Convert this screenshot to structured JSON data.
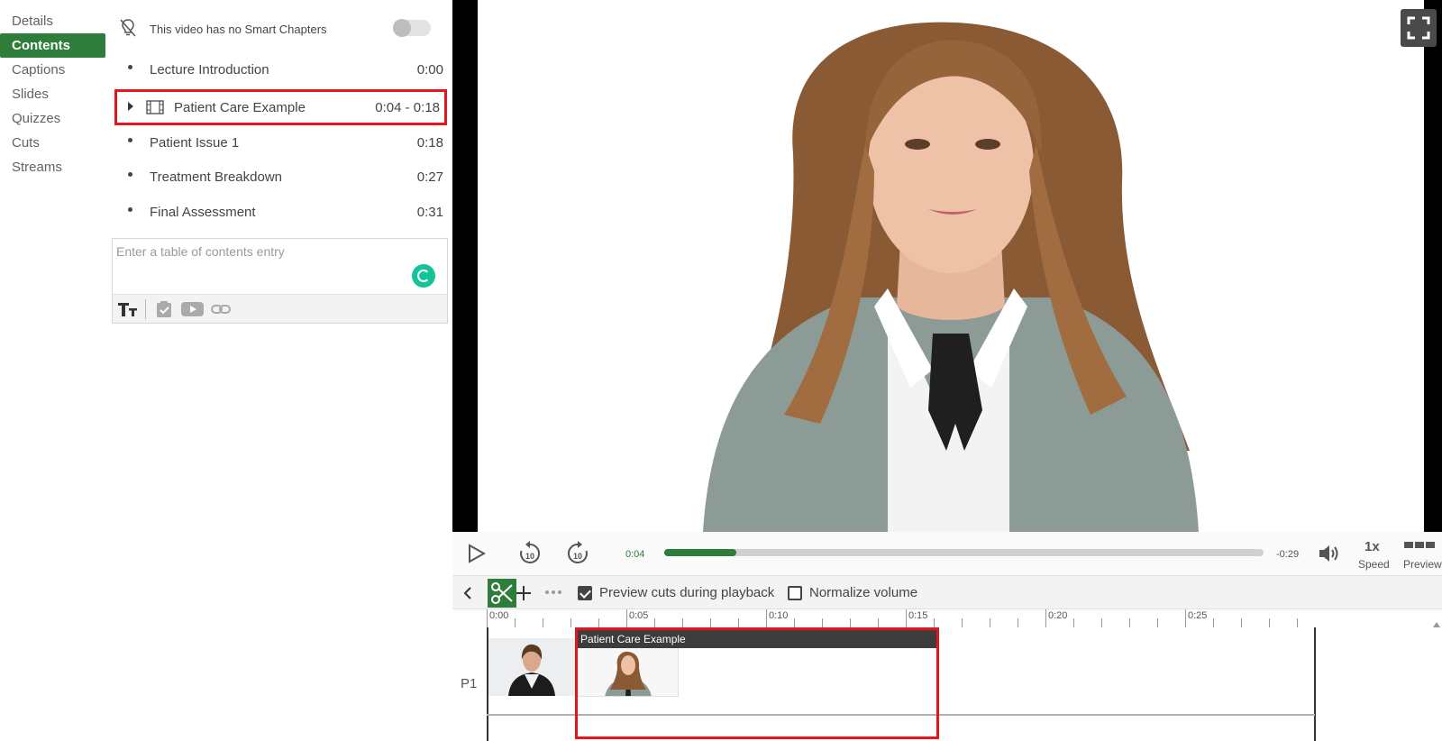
{
  "nav": {
    "items": [
      {
        "label": "Details"
      },
      {
        "label": "Contents"
      },
      {
        "label": "Captions"
      },
      {
        "label": "Slides"
      },
      {
        "label": "Quizzes"
      },
      {
        "label": "Cuts"
      },
      {
        "label": "Streams"
      }
    ],
    "active": "Contents"
  },
  "smart_chapters": {
    "text": "This video has no Smart Chapters",
    "enabled": false
  },
  "toc": [
    {
      "title": "Lecture Introduction",
      "time": "0:00"
    },
    {
      "title": "Patient Care Example",
      "time": "0:04 - 0:18",
      "selected": true
    },
    {
      "title": "Patient Issue 1",
      "time": "0:18"
    },
    {
      "title": "Treatment Breakdown",
      "time": "0:27"
    },
    {
      "title": "Final Assessment",
      "time": "0:31"
    }
  ],
  "editor": {
    "placeholder": "Enter a table of contents entry"
  },
  "player": {
    "current_time": "0:04",
    "remaining_time": "-0:29",
    "progress_fraction": 0.12,
    "speed_value": "1x",
    "speed_label": "Speed",
    "preview_label": "Preview"
  },
  "edit_bar": {
    "preview_cuts_label": "Preview cuts during playback",
    "preview_cuts_checked": true,
    "normalize_label": "Normalize volume",
    "normalize_checked": false
  },
  "timeline": {
    "ticks": [
      "0:00",
      "0:05",
      "0:10",
      "0:15",
      "0:20",
      "0:25"
    ],
    "track_label": "P1",
    "clip_title": "Patient Care Example"
  },
  "colors": {
    "accent": "#2e7d3a",
    "highlight": "#e8141b"
  }
}
